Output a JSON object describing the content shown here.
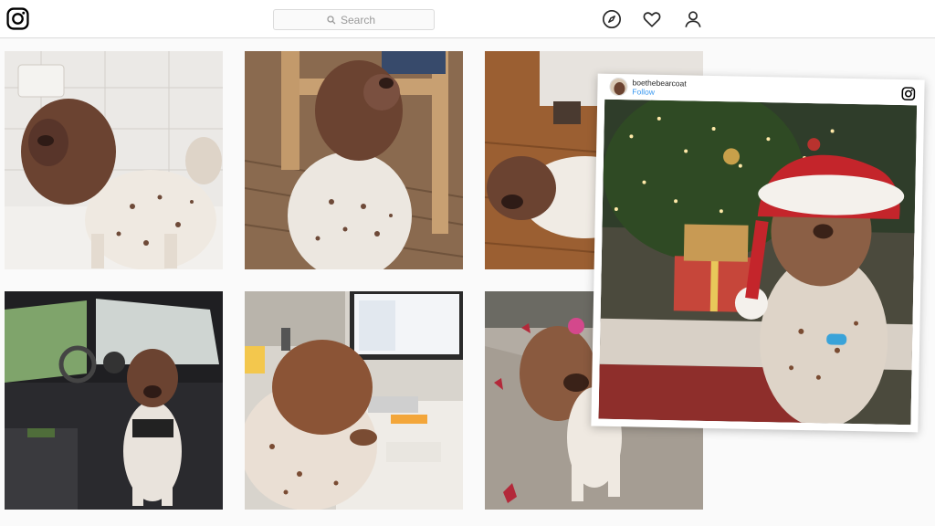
{
  "header": {
    "search_placeholder": "Search",
    "icons": [
      "instagram-logo-icon",
      "search-icon",
      "explore-compass-icon",
      "heart-icon",
      "profile-icon"
    ]
  },
  "grid": {
    "tiles": [
      "photo",
      "photo",
      "photo",
      "photo",
      "photo",
      "photo"
    ]
  },
  "post": {
    "username": "boethebearcoat",
    "follow_label": "Follow"
  },
  "colors": {
    "link_blue": "#3897f0",
    "background": "#fafafa",
    "border": "#dbdbdb",
    "text": "#262626"
  }
}
